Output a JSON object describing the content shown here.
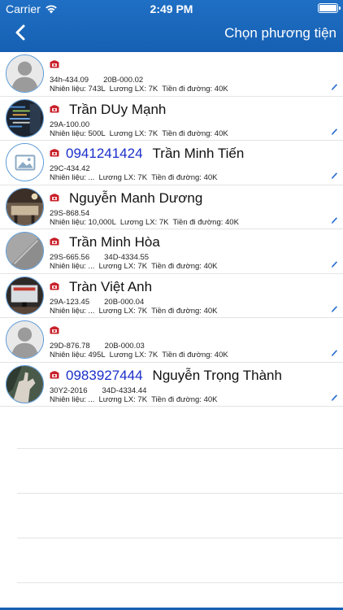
{
  "status_bar": {
    "carrier": "Carrier",
    "time": "2:49 PM"
  },
  "nav": {
    "title": "Chọn phương tiện"
  },
  "rows": [
    {
      "phone": "",
      "name": "",
      "plate1": "34h-434.09",
      "plate2": "20B-000.02",
      "fuel": "Nhiên liệu: 743L",
      "salary": "Lương LX: 7K",
      "road": "Tiền đi đường: 40K",
      "avatar": "person-silhouette"
    },
    {
      "phone": "",
      "name": "Trần DUy Mạnh",
      "plate1": "29A-100.00",
      "plate2": "",
      "fuel": "Nhiên liệu: 500L",
      "salary": "Lương LX: 7K",
      "road": "Tiền đi đường: 40K",
      "avatar": "code-screen-photo"
    },
    {
      "phone": "0941241424",
      "name": "Trần Minh Tiến",
      "plate1": "29C-434.42",
      "plate2": "",
      "fuel": "Nhiên liệu: ...",
      "salary": "Lương LX: 7K",
      "road": "Tiền đi đường: 40K",
      "avatar": "image-placeholder"
    },
    {
      "phone": "",
      "name": "Nguyễn Manh Dương",
      "plate1": "29S-868.54",
      "plate2": "",
      "fuel": "Nhiên liệu: 10,000L",
      "salary": "Lương LX: 7K",
      "road": "Tiền đi đường: 40K",
      "avatar": "desk-photo"
    },
    {
      "phone": "",
      "name": "Trần Minh Hòa",
      "plate1": "29S-665.56",
      "plate2": "34D-4334.55",
      "fuel": "Nhiên liệu: ...",
      "salary": "Lương LX: 7K",
      "road": "Tiền đi đường: 40K",
      "avatar": "gray-photo"
    },
    {
      "phone": "",
      "name": "Tràn Việt Anh",
      "plate1": "29A-123.45",
      "plate2": "20B-000.04",
      "fuel": "Nhiên liệu: ...",
      "salary": "Lương LX: 7K",
      "road": "Tiền đi đường: 40K",
      "avatar": "monitor-photo"
    },
    {
      "phone": "",
      "name": "",
      "plate1": "29D-876.78",
      "plate2": "20B-000.03",
      "fuel": "Nhiên liệu: 495L",
      "salary": "Lương LX: 7K",
      "road": "Tiền đi đường: 40K",
      "avatar": "person-silhouette"
    },
    {
      "phone": "0983927444",
      "name": "Nguyễn Trọng Thành",
      "plate1": "30Y2-2016",
      "plate2": "34D-4334.44",
      "fuel": "Nhiên liệu: ...",
      "salary": "Lương LX: 7K",
      "road": "Tiền đi đường: 40K",
      "avatar": "hand-photo"
    }
  ],
  "colors": {
    "nav": "#1660b3",
    "phone": "#1a2fc9",
    "phone_icon": "#c8202a",
    "avatar_border": "#5a9ad8"
  }
}
